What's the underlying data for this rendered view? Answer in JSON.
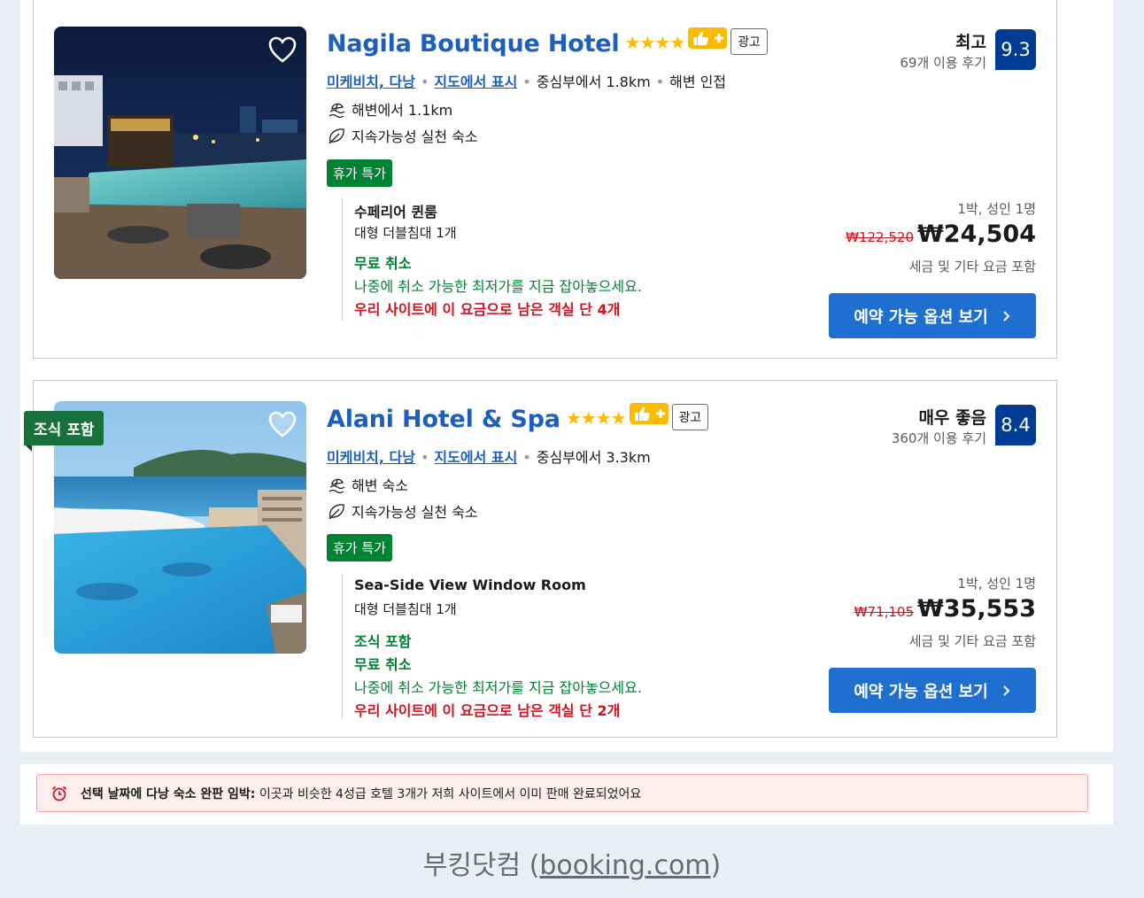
{
  "hotels": [
    {
      "name": "Nagila Boutique Hotel",
      "stars": "★★★★",
      "ad_label": "광고",
      "location": "미케비치, 다낭",
      "map_link": "지도에서 표시",
      "distance": "중심부에서 1.8km",
      "beach_tag": "해변 인접",
      "feature_1": "해변에서 1.1km",
      "feature_2": "지속가능성 실천 숙소",
      "deal": "휴가 특가",
      "room_name": "수페리어 퀸룸",
      "bed": "대형 더블침대 1개",
      "free_cancel": "무료 취소",
      "cancel_note": "나중에 취소 가능한 최저가를 지금 잡아놓으세요.",
      "scarcity": "우리 사이트에 이 요금으로 남은 객실 단 4개",
      "score_word": "최고",
      "reviews": "69개 이용 후기",
      "score": "9.3",
      "nights": "1박, 성인 1명",
      "old_price": "₩122,520",
      "price": "₩24,504",
      "tax": "세금 및 기타 요금 포함",
      "button": "예약 가능 옵션 보기"
    },
    {
      "name": "Alani Hotel & Spa",
      "stars": "★★★★",
      "ad_label": "광고",
      "ribbon": "조식 포함",
      "location": "미케비치, 다낭",
      "map_link": "지도에서 표시",
      "distance": "중심부에서 3.3km",
      "feature_1": "해변 숙소",
      "feature_2": "지속가능성 실천 숙소",
      "deal": "휴가 특가",
      "room_name": "Sea-Side View Window Room",
      "bed": "대형 더블침대 1개",
      "breakfast": "조식 포함",
      "free_cancel": "무료 취소",
      "cancel_note": "나중에 취소 가능한 최저가를 지금 잡아놓으세요.",
      "scarcity": "우리 사이트에 이 요금으로 남은 객실 단 2개",
      "score_word": "매우 좋음",
      "reviews": "360개 이용 후기",
      "score": "8.4",
      "nights": "1박, 성인 1명",
      "old_price": "₩71,105",
      "price": "₩35,553",
      "tax": "세금 및 기타 요금 포함",
      "button": "예약 가능 옵션 보기"
    }
  ],
  "alert": {
    "bold": "선택 날짜에 다낭 숙소 완판 임박:",
    "text": " 이곳과 비슷한 4성급 호텔 3개가 저희 사이트에서 이미 판매 완료되었어요"
  },
  "footer": {
    "prefix": "부킹닷컴 (",
    "link": "booking.com",
    "suffix": ")"
  },
  "colors": {
    "link": "#1d5fbd",
    "score": "#003b95",
    "deal": "#008234",
    "red": "#d4111e",
    "button": "#1f6fd1"
  },
  "icons": [
    "heart-icon",
    "thumbs-up-plus-icon",
    "beach-icon",
    "leaf-icon",
    "chevron-right-icon",
    "alarm-clock-icon"
  ]
}
